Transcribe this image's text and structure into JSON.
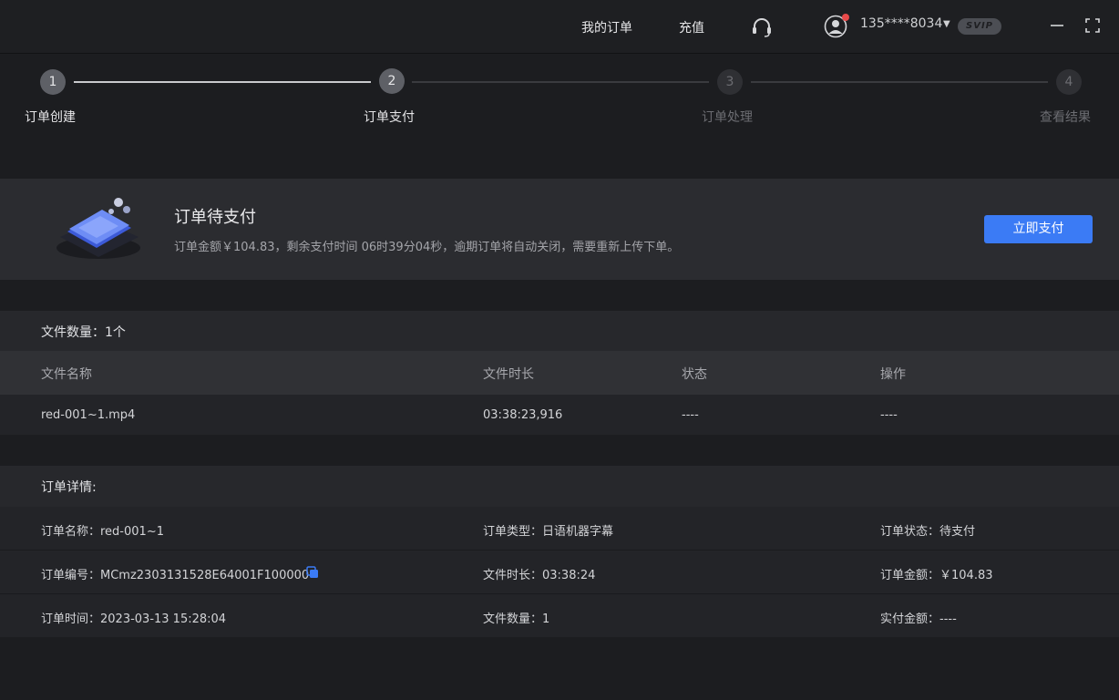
{
  "header": {
    "my_orders": "我的订单",
    "recharge": "充值",
    "account": "135****8034",
    "badge": "SVIP"
  },
  "steps": [
    {
      "num": "1",
      "label": "订单创建",
      "state": "done"
    },
    {
      "num": "2",
      "label": "订单支付",
      "state": "current"
    },
    {
      "num": "3",
      "label": "订单处理",
      "state": "pending"
    },
    {
      "num": "4",
      "label": "查看结果",
      "state": "pending"
    }
  ],
  "payment": {
    "title": "订单待支付",
    "desc": "订单金额￥104.83，剩余支付时间 06时39分04秒，逾期订单将自动关闭，需要重新上传下单。",
    "button": "立即支付"
  },
  "files": {
    "count_label": "文件数量：1个",
    "columns": [
      "文件名称",
      "文件时长",
      "状态",
      "操作"
    ],
    "rows": [
      [
        "red-001~1.mp4",
        "03:38:23,916",
        "----",
        "----"
      ]
    ]
  },
  "details": {
    "title": "订单详情:",
    "rows": [
      [
        "订单名称：red-001~1",
        "订单类型：日语机器字幕",
        "订单状态：待支付"
      ],
      [
        "订单编号：MCmz2303131528E64001F100000",
        "文件时长：03:38:24",
        "订单金额：￥104.83"
      ],
      [
        "订单时间：2023-03-13 15:28:04",
        "文件数量：1",
        "实付金额：----"
      ]
    ]
  },
  "colors": {
    "accent": "#3b7bf5",
    "badge_dot": "#e84a4a"
  },
  "icons": [
    "headset-icon",
    "user-avatar-icon",
    "minimize-icon",
    "fullscreen-icon",
    "copy-icon",
    "payment-illustration"
  ]
}
